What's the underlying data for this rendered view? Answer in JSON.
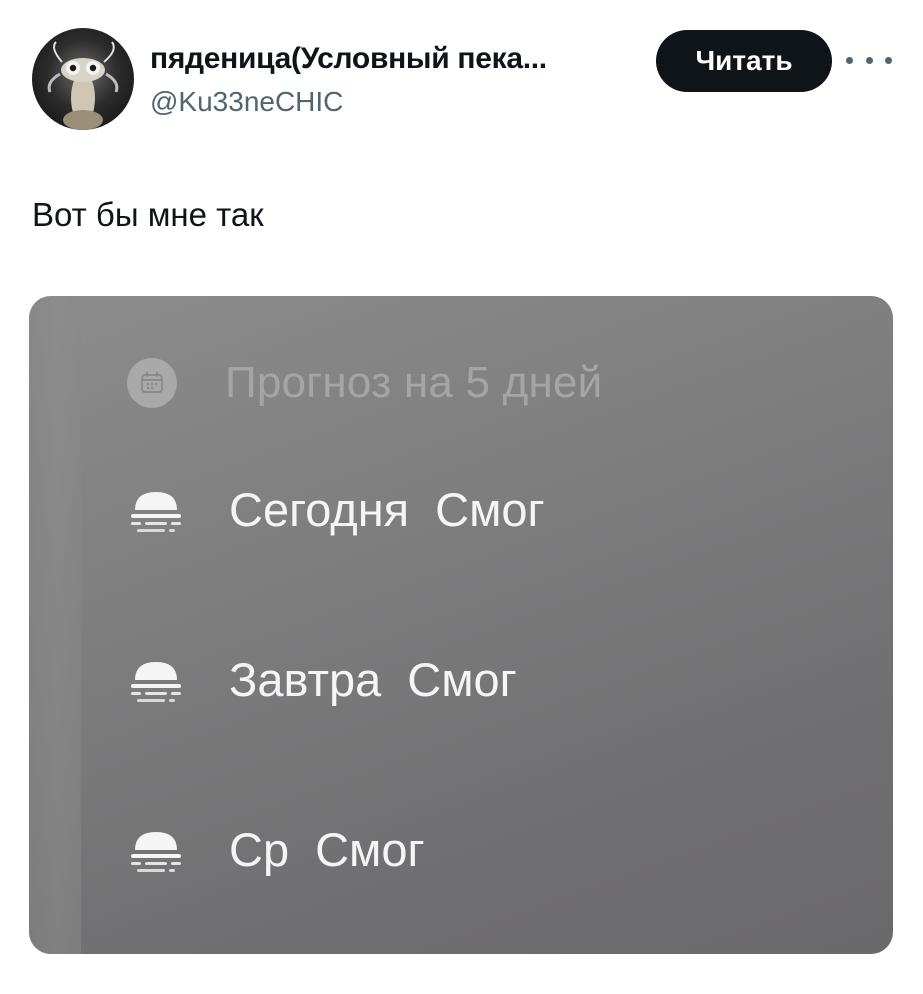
{
  "author": {
    "display_name": "пяденица(Условный пека...",
    "handle": "@Ku33neCHIC",
    "avatar": "avatar-photo"
  },
  "header": {
    "follow_label": "Читать",
    "more_icon": "more-dots-icon"
  },
  "tweet": {
    "text": "Вот бы мне так"
  },
  "widget": {
    "title": "Прогноз на 5 дней",
    "title_icon": "calendar-icon",
    "rows": [
      {
        "day": "Сегодня",
        "condition": "Смог",
        "icon": "fog-icon"
      },
      {
        "day": "Завтра",
        "condition": "Смог",
        "icon": "fog-icon"
      },
      {
        "day": "Ср",
        "condition": "Смог",
        "icon": "fog-icon"
      }
    ]
  },
  "colors": {
    "text_primary": "#0f1419",
    "text_secondary": "#536471",
    "button_bg": "#0f1419",
    "widget_bg": "#7e7d7e",
    "widget_text": "#f5f5f5",
    "widget_title": "#a5a5a5"
  }
}
